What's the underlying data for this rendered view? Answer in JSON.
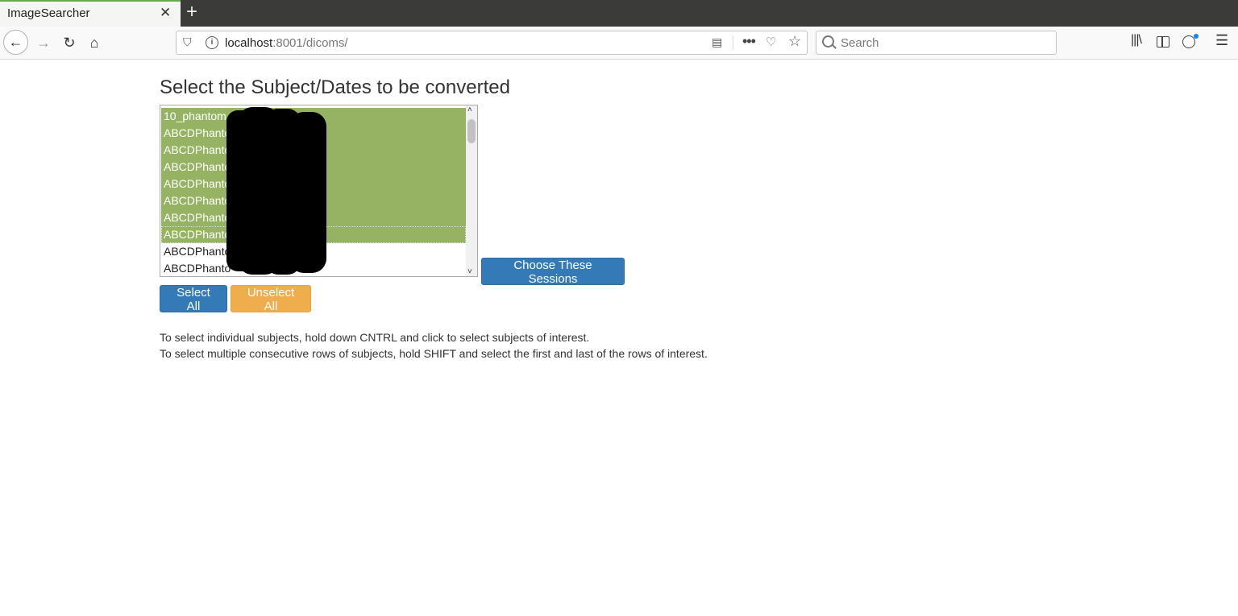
{
  "browser": {
    "tab_title": "ImageSearcher",
    "tab_close": "✕",
    "new_tab": "+",
    "url_host": "localhost",
    "url_rest": ":8001/dicoms/",
    "search_placeholder": "Search"
  },
  "page": {
    "title": "Select the Subject/Dates to be converted",
    "subjects": [
      {
        "label": "10_phantom",
        "selected": true
      },
      {
        "label": "ABCDPhanto",
        "selected": true
      },
      {
        "label": "ABCDPhanto",
        "selected": true
      },
      {
        "label": "ABCDPhantom",
        "selected": true
      },
      {
        "label": "ABCDPhanto",
        "selected": true
      },
      {
        "label": "ABCDPhanto",
        "selected": true
      },
      {
        "label": "ABCDPhanto",
        "selected": true
      },
      {
        "label": "ABCDPhanto",
        "selected": true
      },
      {
        "label": "ABCDPhanto",
        "selected": false
      },
      {
        "label": "ABCDPhanto",
        "selected": false
      }
    ],
    "choose_button": "Choose These Sessions",
    "select_all_button": "Select All",
    "unselect_all_button": "Unselect All",
    "help_line_1": "To select individual subjects, hold down CNTRL and click to select subjects of interest.",
    "help_line_2": "To select multiple consecutive rows of subjects, hold SHIFT and select the first and last of the rows of interest."
  },
  "colors": {
    "selected_row": "#96b363",
    "primary_button": "#337ab7",
    "warning_button": "#f0ad4e"
  },
  "icons": [
    "back-arrow-icon",
    "forward-arrow-icon",
    "reload-icon",
    "home-icon",
    "shield-icon",
    "info-icon",
    "reader-view-icon",
    "more-icon",
    "pocket-icon",
    "star-icon",
    "search-icon",
    "library-icon",
    "sidebar-icon",
    "account-icon",
    "hamburger-menu-icon"
  ]
}
